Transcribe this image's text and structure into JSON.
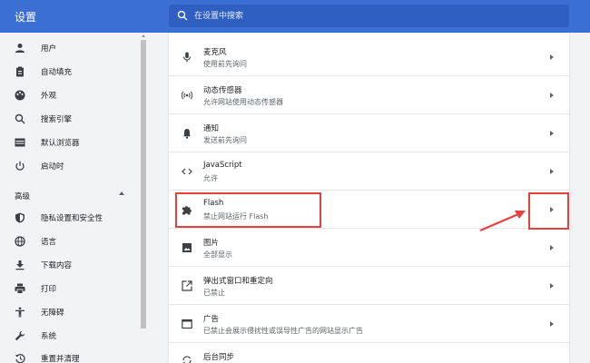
{
  "header": {
    "title": "设置",
    "search_placeholder": "在设置中搜索"
  },
  "sidebar": {
    "items": [
      {
        "label": "用户",
        "icon": "person-icon"
      },
      {
        "label": "自动填充",
        "icon": "clipboard-icon"
      },
      {
        "label": "外观",
        "icon": "palette-icon"
      },
      {
        "label": "搜索引擎",
        "icon": "search-icon"
      },
      {
        "label": "默认浏览器",
        "icon": "browser-icon"
      },
      {
        "label": "启动时",
        "icon": "power-icon"
      }
    ],
    "advanced_label": "高级",
    "advanced_items": [
      {
        "label": "隐私设置和安全性",
        "icon": "shield-icon"
      },
      {
        "label": "语言",
        "icon": "globe-icon"
      },
      {
        "label": "下载内容",
        "icon": "download-icon"
      },
      {
        "label": "打印",
        "icon": "printer-icon"
      },
      {
        "label": "无障碍",
        "icon": "accessibility-icon"
      },
      {
        "label": "系统",
        "icon": "wrench-icon"
      },
      {
        "label": "重置并清理",
        "icon": "history-icon"
      }
    ]
  },
  "content": {
    "rows": [
      {
        "title": "麦克风",
        "subtitle": "使用前先询问",
        "icon": "microphone-icon"
      },
      {
        "title": "动态传感器",
        "subtitle": "允许网站使用动态传感器",
        "icon": "sensor-icon"
      },
      {
        "title": "通知",
        "subtitle": "发送前先询问",
        "icon": "bell-icon"
      },
      {
        "title": "JavaScript",
        "subtitle": "允许",
        "icon": "code-icon"
      },
      {
        "title": "Flash",
        "subtitle": "禁止网站运行 Flash",
        "icon": "puzzle-icon"
      },
      {
        "title": "图片",
        "subtitle": "全部显示",
        "icon": "image-icon"
      },
      {
        "title": "弹出式窗口和重定向",
        "subtitle": "已禁止",
        "icon": "popup-icon"
      },
      {
        "title": "广告",
        "subtitle": "已禁止会展示侵扰性或误导性广告的网站显示广告",
        "icon": "ad-icon"
      },
      {
        "title": "后台同步",
        "subtitle": "",
        "icon": "sync-icon"
      }
    ]
  },
  "colors": {
    "header": "#3c6fd4",
    "highlight": "#e8413b"
  }
}
